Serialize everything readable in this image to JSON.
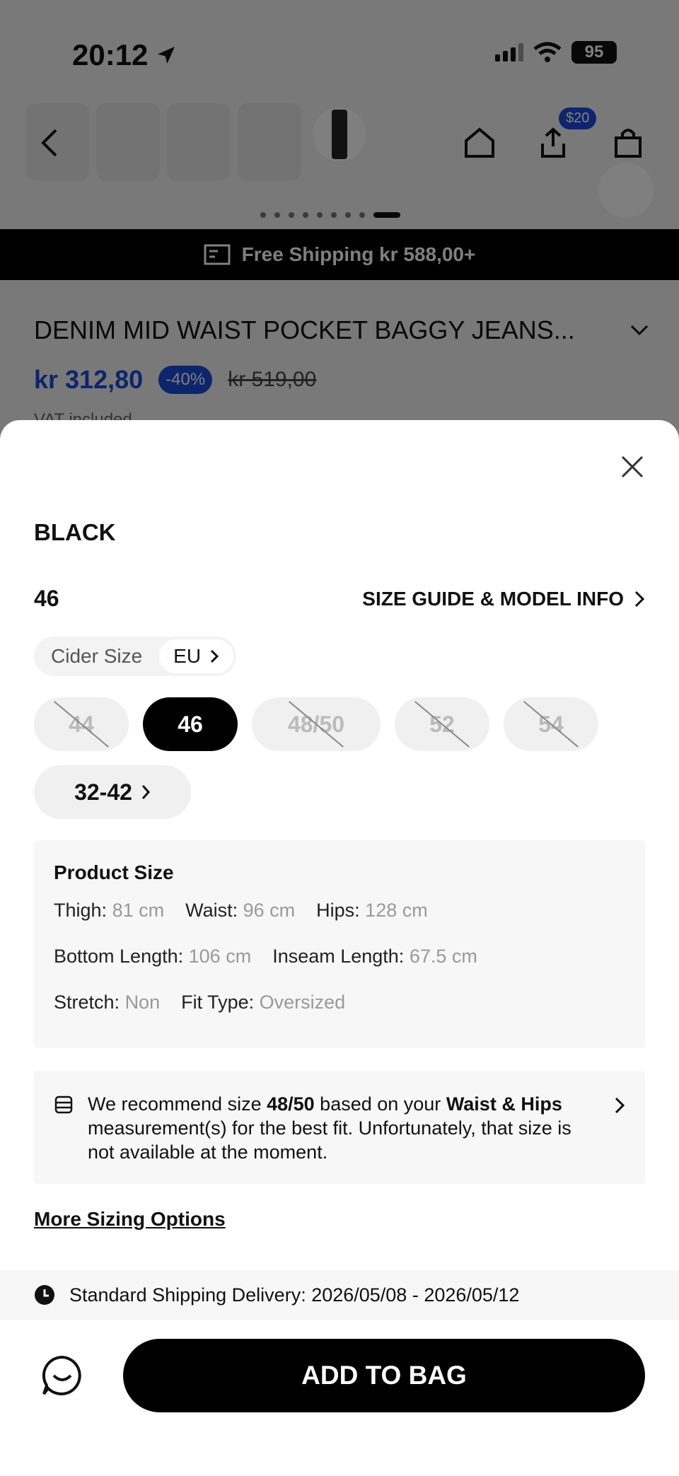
{
  "status_bar": {
    "time": "20:12",
    "battery": "95"
  },
  "nav": {
    "coupon_badge": "$20"
  },
  "banner": {
    "text": "Free Shipping kr 588,00+"
  },
  "product": {
    "title": "DENIM MID WAIST POCKET BAGGY JEANS...",
    "price": "kr 312,80",
    "discount": "-40%",
    "old_price": "kr 519,00",
    "vat": "VAT included"
  },
  "sheet": {
    "color_name": "BLACK",
    "selected_size": "46",
    "size_guide": "SIZE GUIDE & MODEL INFO",
    "size_system_label": "Cider Size",
    "size_system_unit": "EU",
    "sizes": [
      {
        "label": "44",
        "state": "disabled"
      },
      {
        "label": "46",
        "state": "selected"
      },
      {
        "label": "48/50",
        "state": "disabled"
      },
      {
        "label": "52",
        "state": "disabled"
      },
      {
        "label": "54",
        "state": "disabled"
      },
      {
        "label": "32-42",
        "state": "more"
      }
    ],
    "product_size": {
      "heading": "Product Size",
      "thigh_label": "Thigh:",
      "thigh_value": "81 cm",
      "waist_label": "Waist:",
      "waist_value": "96 cm",
      "hips_label": "Hips:",
      "hips_value": "128 cm",
      "bottom_length_label": "Bottom Length:",
      "bottom_length_value": "106 cm",
      "inseam_label": "Inseam Length:",
      "inseam_value": "67.5 cm",
      "stretch_label": "Stretch:",
      "stretch_value": "Non",
      "fit_label": "Fit Type:",
      "fit_value": "Oversized"
    },
    "recommend": {
      "part1": "We recommend size ",
      "size": "48/50",
      "part2": " based on your ",
      "measure": "Waist & Hips",
      "part3": " measurement(s) for the best fit. Unfortunately, that size is not available at the moment."
    },
    "more_sizing": "More Sizing Options",
    "delivery": "Standard Shipping Delivery: 2026/05/08 - 2026/05/12",
    "add_to_bag": "ADD TO BAG"
  }
}
